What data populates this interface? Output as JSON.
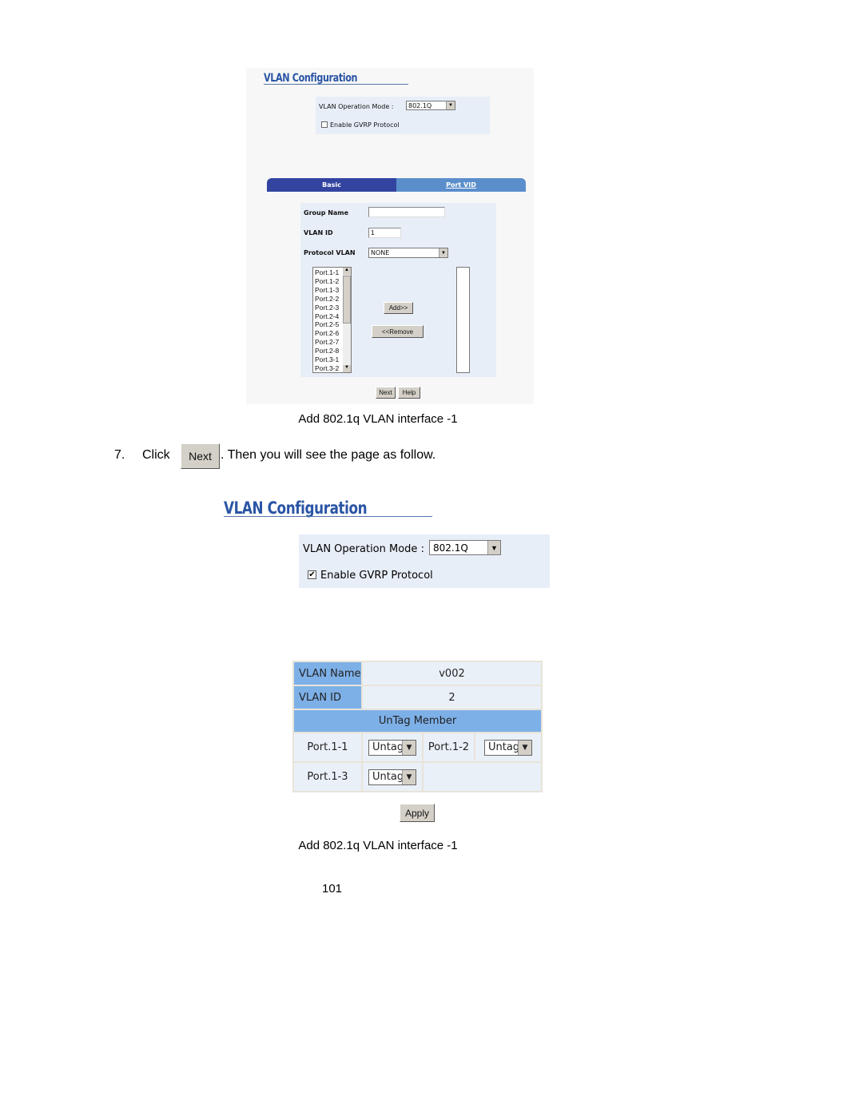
{
  "screenshot1": {
    "title": "VLAN Configuration",
    "mode_label": "VLAN Operation Mode :",
    "mode_value": "802.1Q",
    "gvrp_label": "Enable GVRP Protocol",
    "gvrp_checked": false,
    "tabs": [
      {
        "label": "Basic",
        "active": true
      },
      {
        "label": "Port VID",
        "active": false
      }
    ],
    "group_name_label": "Group Name",
    "group_name_value": "",
    "vlan_id_label": "VLAN ID",
    "vlan_id_value": "1",
    "protocol_vlan_label": "Protocol VLAN",
    "protocol_vlan_value": "NONE",
    "ports": [
      "Port.1-1",
      "Port.1-2",
      "Port.1-3",
      "Port.2-2",
      "Port.2-3",
      "Port.2-4",
      "Port.2-5",
      "Port.2-6",
      "Port.2-7",
      "Port.2-8",
      "Port.3-1",
      "Port.3-2"
    ],
    "add_label": "Add>>",
    "remove_label": "<<Remove",
    "next_label": "Next",
    "help_label": "Help"
  },
  "caption1": "Add 802.1q VLAN interface -1",
  "step": {
    "number": "7.",
    "before": "Click",
    "button": "Next",
    "after": ". Then you will see the page as follow."
  },
  "screenshot2": {
    "title": "VLAN Configuration",
    "mode_label": "VLAN Operation Mode :",
    "mode_value": "802.1Q",
    "gvrp_label": "Enable GVRP Protocol",
    "gvrp_checked": true,
    "vlan_name_label": "VLAN Name",
    "vlan_name_value": "v002",
    "vlan_id_label": "VLAN ID",
    "vlan_id_value": "2",
    "untag_header": "UnTag Member",
    "members": [
      {
        "port": "Port.1-1",
        "value": "Untag"
      },
      {
        "port": "Port.1-2",
        "value": "Untag"
      },
      {
        "port": "Port.1-3",
        "value": "Untag"
      }
    ],
    "apply_label": "Apply"
  },
  "caption2": "Add 802.1q VLAN interface -1",
  "page_number": "101",
  "colors": {
    "title": "#2a55a5",
    "panel": "#e8eef8",
    "tab_active": "#3344a0",
    "tab_inactive": "#5b8fcc",
    "table_header": "#7eb0e8"
  }
}
